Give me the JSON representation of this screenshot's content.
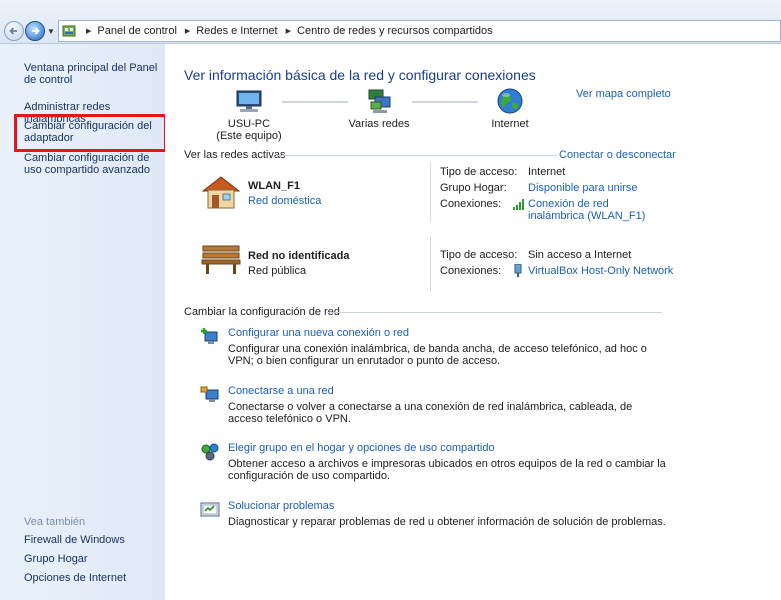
{
  "breadcrumb": [
    "Panel de control",
    "Redes e Internet",
    "Centro de redes y recursos compartidos"
  ],
  "sidebar": {
    "items": [
      {
        "label": "Ventana principal del Panel de control"
      },
      {
        "label": "Administrar redes inalámbricas"
      },
      {
        "label": "Cambiar configuración del adaptador"
      },
      {
        "label": "Cambiar configuración de uso compartido avanzado"
      }
    ],
    "see_also_title": "Vea también",
    "see_also": [
      {
        "label": "Firewall de Windows"
      },
      {
        "label": "Grupo Hogar"
      },
      {
        "label": "Opciones de Internet"
      }
    ]
  },
  "main": {
    "title": "Ver información básica de la red y configurar conexiones",
    "full_map": "Ver mapa completo",
    "map": {
      "pc_name": "USU-PC",
      "pc_sub": "(Este equipo)",
      "networks": "Varias redes",
      "internet": "Internet"
    },
    "active_header": "Ver las redes activas",
    "connect_link": "Conectar o desconectar",
    "networks": [
      {
        "name": "WLAN_F1",
        "type": "Red doméstica",
        "access_label": "Tipo de acceso:",
        "access_value": "Internet",
        "homegroup_label": "Grupo Hogar:",
        "homegroup_value": "Disponible para unirse",
        "connections_label": "Conexiones:",
        "connection_value": "Conexión de red inalámbrica (WLAN_F1)"
      },
      {
        "name": "Red no identificada",
        "type": "Red pública",
        "access_label": "Tipo de acceso:",
        "access_value": "Sin acceso a Internet",
        "connections_label": "Conexiones:",
        "connection_value": "VirtualBox Host-Only Network"
      }
    ],
    "change_header": "Cambiar la configuración de red",
    "tasks": [
      {
        "title": "Configurar una nueva conexión o red",
        "desc": "Configurar una conexión inalámbrica, de banda ancha, de acceso telefónico, ad hoc o VPN; o bien configurar un enrutador o punto de acceso."
      },
      {
        "title": "Conectarse a una red",
        "desc": "Conectarse o volver a conectarse a una conexión de red inalámbrica, cableada, de acceso telefónico o VPN."
      },
      {
        "title": "Elegir grupo en el hogar y opciones de uso compartido",
        "desc": "Obtener acceso a archivos e impresoras ubicados en otros equipos de la red o cambiar la configuración de uso compartido."
      },
      {
        "title": "Solucionar problemas",
        "desc": "Diagnosticar y reparar problemas de red u obtener información de solución de problemas."
      }
    ]
  },
  "colors": {
    "link": "#1c5fb7",
    "title": "#1a3d8f",
    "highlight": "#e3161e",
    "sidebar_bg": "#e9f1fb"
  }
}
